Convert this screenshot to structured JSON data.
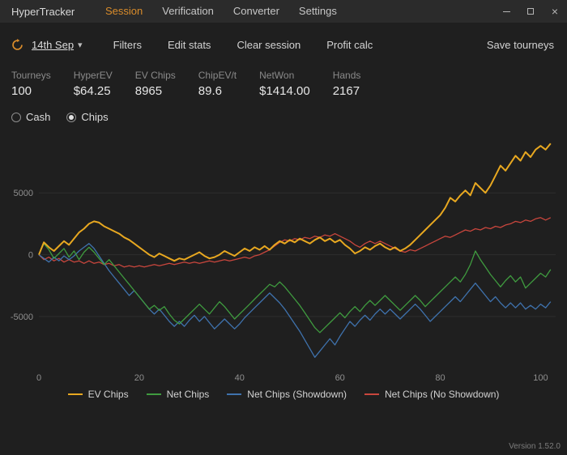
{
  "titlebar": {
    "app_title": "HyperTracker",
    "menu": [
      {
        "label": "Session",
        "active": true
      },
      {
        "label": "Verification",
        "active": false
      },
      {
        "label": "Converter",
        "active": false
      },
      {
        "label": "Settings",
        "active": false
      }
    ],
    "close_glyph": "×"
  },
  "toolbar": {
    "date_label": "14th Sep",
    "date_caret": "▾",
    "buttons": [
      "Filters",
      "Edit stats",
      "Clear session",
      "Profit calc"
    ],
    "save_label": "Save tourneys"
  },
  "stats": [
    {
      "label": "Tourneys",
      "value": "100"
    },
    {
      "label": "HyperEV",
      "value": "$64.25"
    },
    {
      "label": "EV Chips",
      "value": "8965"
    },
    {
      "label": "ChipEV/t",
      "value": "89.6"
    },
    {
      "label": "NetWon",
      "value": "$1414.00"
    },
    {
      "label": "Hands",
      "value": "2167"
    }
  ],
  "radios": [
    {
      "label": "Cash",
      "selected": false
    },
    {
      "label": "Chips",
      "selected": true
    }
  ],
  "accent_color": "#d98c2b",
  "chart_data": {
    "type": "line",
    "title": "",
    "xlabel": "",
    "ylabel": "",
    "xlim": [
      0,
      103
    ],
    "ylim": [
      -9000,
      9600
    ],
    "x_ticks": [
      0,
      20,
      40,
      60,
      80,
      100
    ],
    "y_ticks": [
      -5000,
      0,
      5000
    ],
    "grid": "horizontal-only",
    "legend_position": "bottom",
    "series": [
      {
        "name": "EV Chips",
        "color": "#e8a820",
        "values": [
          0,
          1000,
          600,
          300,
          700,
          1100,
          800,
          1300,
          1800,
          2100,
          2500,
          2700,
          2600,
          2300,
          2100,
          1900,
          1700,
          1400,
          1200,
          900,
          600,
          300,
          0,
          -200,
          100,
          -100,
          -300,
          -500,
          -300,
          -400,
          -200,
          0,
          200,
          -100,
          -300,
          -200,
          0,
          300,
          100,
          -100,
          200,
          500,
          300,
          600,
          400,
          700,
          400,
          800,
          1100,
          900,
          1200,
          1000,
          1300,
          1100,
          900,
          1200,
          1400,
          1100,
          1300,
          1000,
          1200,
          800,
          500,
          100,
          300,
          600,
          400,
          700,
          900,
          600,
          400,
          600,
          300,
          500,
          800,
          1200,
          1600,
          2000,
          2400,
          2800,
          3200,
          3800,
          4600,
          4300,
          4800,
          5200,
          4800,
          5800,
          5400,
          5000,
          5600,
          6400,
          7200,
          6800,
          7400,
          8000,
          7600,
          8300,
          7900,
          8500,
          8800,
          8500,
          9000
        ]
      },
      {
        "name": "Net Chips",
        "color": "#3f9b3f",
        "values": [
          0,
          900,
          400,
          -300,
          100,
          500,
          -200,
          300,
          -400,
          200,
          600,
          200,
          -300,
          -800,
          -400,
          -900,
          -1400,
          -1900,
          -2400,
          -2900,
          -3400,
          -3900,
          -4400,
          -4100,
          -4500,
          -4200,
          -4800,
          -5300,
          -5600,
          -5200,
          -4800,
          -4400,
          -4000,
          -4400,
          -4800,
          -4300,
          -3800,
          -4200,
          -4700,
          -5200,
          -4800,
          -4400,
          -4000,
          -3600,
          -3200,
          -2800,
          -2400,
          -2600,
          -2200,
          -2600,
          -3100,
          -3600,
          -4100,
          -4700,
          -5300,
          -5900,
          -6300,
          -5900,
          -5500,
          -5100,
          -4700,
          -5100,
          -4600,
          -4200,
          -4600,
          -4100,
          -3700,
          -4100,
          -3700,
          -3300,
          -3700,
          -4100,
          -4500,
          -4100,
          -3700,
          -3300,
          -3700,
          -4200,
          -3800,
          -3400,
          -3000,
          -2600,
          -2200,
          -1800,
          -2200,
          -1600,
          -800,
          300,
          -400,
          -1000,
          -1600,
          -2100,
          -2600,
          -2100,
          -1700,
          -2200,
          -1800,
          -2700,
          -2300,
          -1900,
          -1500,
          -1800,
          -1200
        ]
      },
      {
        "name": "Net Chips (Showdown)",
        "color": "#3f72ad",
        "values": [
          0,
          -300,
          -600,
          -200,
          -500,
          -100,
          -400,
          -100,
          300,
          600,
          900,
          500,
          -100,
          -700,
          -1300,
          -1800,
          -2300,
          -2800,
          -3300,
          -2900,
          -3400,
          -3900,
          -4400,
          -4800,
          -4400,
          -4900,
          -5400,
          -5800,
          -5400,
          -5800,
          -5300,
          -4900,
          -5400,
          -5000,
          -5500,
          -6000,
          -5600,
          -5200,
          -5600,
          -6000,
          -5600,
          -5100,
          -4700,
          -4300,
          -3900,
          -3500,
          -3100,
          -3500,
          -3900,
          -4400,
          -5000,
          -5600,
          -6200,
          -6900,
          -7600,
          -8300,
          -7800,
          -7300,
          -6800,
          -7300,
          -6600,
          -6000,
          -5400,
          -5800,
          -5300,
          -4900,
          -5300,
          -4800,
          -4400,
          -4800,
          -4400,
          -4800,
          -5200,
          -4800,
          -4400,
          -4000,
          -4400,
          -4900,
          -5400,
          -5000,
          -4600,
          -4200,
          -3800,
          -3400,
          -3800,
          -3300,
          -2800,
          -2300,
          -2800,
          -3300,
          -3800,
          -3400,
          -3900,
          -4300,
          -3900,
          -4300,
          -3900,
          -4400,
          -4100,
          -4400,
          -4000,
          -4300,
          -3800
        ]
      },
      {
        "name": "Net Chips (No Showdown)",
        "color": "#c9463d",
        "values": [
          0,
          -400,
          -200,
          -500,
          -300,
          -600,
          -400,
          -600,
          -500,
          -700,
          -500,
          -700,
          -600,
          -800,
          -700,
          -900,
          -800,
          -1000,
          -900,
          -1000,
          -900,
          -1000,
          -900,
          -800,
          -900,
          -800,
          -700,
          -800,
          -700,
          -600,
          -700,
          -600,
          -700,
          -600,
          -500,
          -600,
          -500,
          -400,
          -500,
          -400,
          -300,
          -200,
          -300,
          -100,
          0,
          200,
          400,
          700,
          1000,
          1200,
          1100,
          1300,
          1200,
          1400,
          1300,
          1500,
          1400,
          1600,
          1500,
          1700,
          1500,
          1300,
          1100,
          800,
          600,
          900,
          1100,
          900,
          1100,
          900,
          700,
          500,
          300,
          200,
          400,
          300,
          500,
          700,
          900,
          1100,
          1300,
          1500,
          1400,
          1600,
          1800,
          2000,
          1900,
          2100,
          2000,
          2200,
          2100,
          2300,
          2200,
          2400,
          2500,
          2700,
          2600,
          2800,
          2700,
          2900,
          3000,
          2800,
          3000
        ]
      }
    ]
  },
  "version": "Version 1.52.0"
}
